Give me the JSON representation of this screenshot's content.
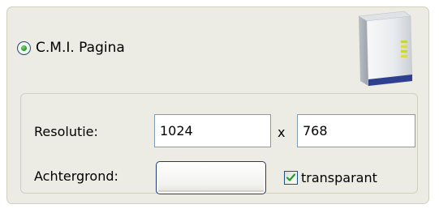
{
  "page": {
    "mode_option": {
      "label": "C.M.I. Pagina",
      "selected": true
    },
    "device_image": {
      "icon": "router-device-icon"
    },
    "resolution": {
      "label": "Resolutie:",
      "width_value": "1024",
      "separator": "x",
      "height_value": "768"
    },
    "background": {
      "label": "Achtergrond:",
      "color_value": "",
      "transparent_label": "transparant",
      "transparent_checked": true
    }
  },
  "colors": {
    "panel_bg": "#ecebe4",
    "border": "#d0d0bf",
    "field_border": "#7f9db9",
    "accent_green": "#2fa32f",
    "control_border": "#1c5180"
  }
}
